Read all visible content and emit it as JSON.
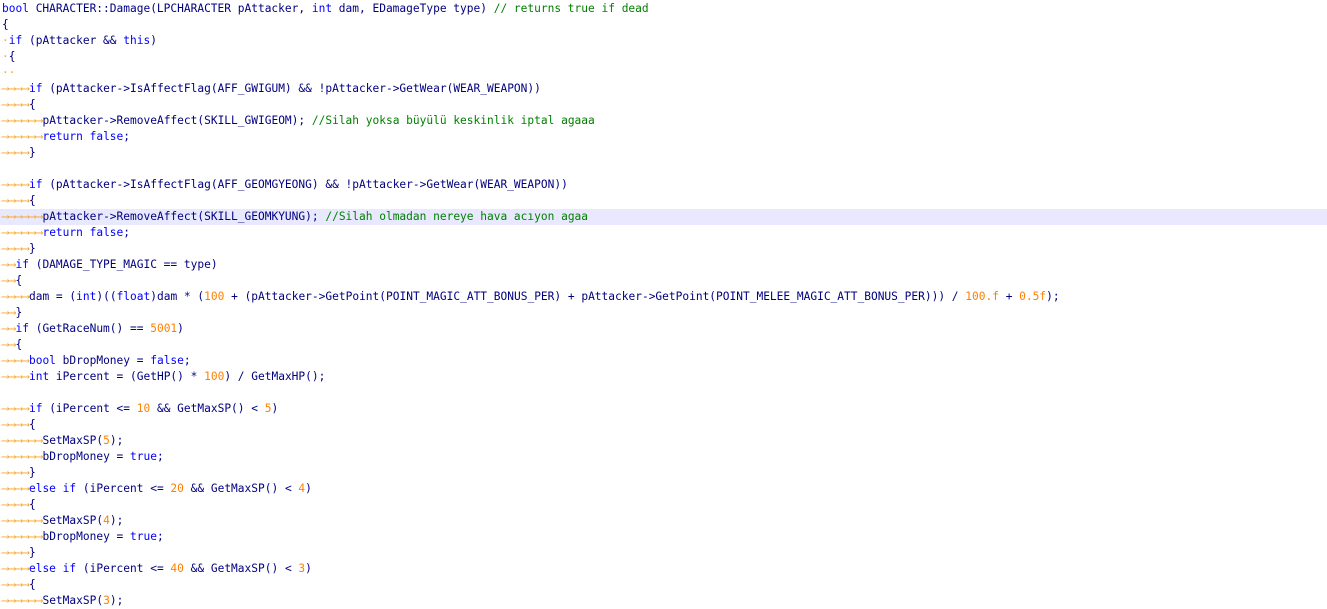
{
  "editor": {
    "tab_arrow": "⟶⟶",
    "lines": [
      {
        "indent": 0,
        "segments": [
          {
            "t": "kw",
            "v": "bool"
          },
          {
            "t": "id",
            "v": " CHARACTER::Damage(LPCHARACTER pAttacker, "
          },
          {
            "t": "kw",
            "v": "int"
          },
          {
            "t": "id",
            "v": " dam, EDamageType type) "
          },
          {
            "t": "cm",
            "v": "// returns true if dead"
          }
        ]
      },
      {
        "indent": 0,
        "segments": [
          {
            "t": "id",
            "v": "{"
          }
        ]
      },
      {
        "indent": 0,
        "segments": [
          {
            "t": "ws",
            "v": "·"
          },
          {
            "t": "kw",
            "v": "if"
          },
          {
            "t": "id",
            "v": " (pAttacker && "
          },
          {
            "t": "kw",
            "v": "this"
          },
          {
            "t": "id",
            "v": ")"
          }
        ]
      },
      {
        "indent": 0,
        "segments": [
          {
            "t": "ws",
            "v": "·"
          },
          {
            "t": "id",
            "v": "{"
          }
        ]
      },
      {
        "indent": 0,
        "segments": [
          {
            "t": "ws",
            "v": "··"
          }
        ]
      },
      {
        "indent": 2,
        "segments": [
          {
            "t": "kw",
            "v": "if"
          },
          {
            "t": "id",
            "v": " (pAttacker->IsAffectFlag(AFF_GWIGUM) && !pAttacker->GetWear(WEAR_WEAPON))"
          }
        ]
      },
      {
        "indent": 2,
        "segments": [
          {
            "t": "id",
            "v": "{"
          }
        ]
      },
      {
        "indent": 3,
        "segments": [
          {
            "t": "id",
            "v": "pAttacker->RemoveAffect(SKILL_GWIGEOM); "
          },
          {
            "t": "cm",
            "v": "//Silah yoksa büyülü keskinlik iptal agaaa"
          }
        ]
      },
      {
        "indent": 3,
        "segments": [
          {
            "t": "kw",
            "v": "return false"
          },
          {
            "t": "id",
            "v": ";"
          }
        ]
      },
      {
        "indent": 2,
        "segments": [
          {
            "t": "id",
            "v": "}"
          }
        ]
      },
      {
        "indent": 0,
        "segments": []
      },
      {
        "indent": 2,
        "segments": [
          {
            "t": "kw",
            "v": "if"
          },
          {
            "t": "id",
            "v": " (pAttacker->IsAffectFlag(AFF_GEOMGYEONG) && !pAttacker->GetWear(WEAR_WEAPON))"
          }
        ]
      },
      {
        "indent": 2,
        "segments": [
          {
            "t": "id",
            "v": "{"
          }
        ]
      },
      {
        "indent": 3,
        "current": true,
        "segments": [
          {
            "t": "id",
            "v": "pAttacker->RemoveAffect(SKILL_GEOMKYUNG); "
          },
          {
            "t": "cm",
            "v": "//Silah olmadan nereye hava acıyon agaa"
          }
        ]
      },
      {
        "indent": 3,
        "segments": [
          {
            "t": "kw",
            "v": "return false"
          },
          {
            "t": "id",
            "v": ";"
          }
        ]
      },
      {
        "indent": 2,
        "segments": [
          {
            "t": "id",
            "v": "}"
          }
        ]
      },
      {
        "indent": 1,
        "segments": [
          {
            "t": "kw",
            "v": "if"
          },
          {
            "t": "id",
            "v": " (DAMAGE_TYPE_MAGIC == type)"
          }
        ]
      },
      {
        "indent": 1,
        "segments": [
          {
            "t": "id",
            "v": "{"
          }
        ]
      },
      {
        "indent": 2,
        "segments": [
          {
            "t": "id",
            "v": "dam = ("
          },
          {
            "t": "kw",
            "v": "int"
          },
          {
            "t": "id",
            "v": ")(("
          },
          {
            "t": "kw",
            "v": "float"
          },
          {
            "t": "id",
            "v": ")dam * ("
          },
          {
            "t": "num",
            "v": "100"
          },
          {
            "t": "id",
            "v": " + (pAttacker->GetPoint(POINT_MAGIC_ATT_BONUS_PER) + pAttacker->GetPoint(POINT_MELEE_MAGIC_ATT_BONUS_PER))) / "
          },
          {
            "t": "num",
            "v": "100.f"
          },
          {
            "t": "id",
            "v": " + "
          },
          {
            "t": "num",
            "v": "0.5f"
          },
          {
            "t": "id",
            "v": ");"
          }
        ]
      },
      {
        "indent": 1,
        "segments": [
          {
            "t": "id",
            "v": "}"
          }
        ]
      },
      {
        "indent": 1,
        "segments": [
          {
            "t": "kw",
            "v": "if"
          },
          {
            "t": "id",
            "v": " (GetRaceNum() == "
          },
          {
            "t": "num",
            "v": "5001"
          },
          {
            "t": "id",
            "v": ")"
          }
        ]
      },
      {
        "indent": 1,
        "segments": [
          {
            "t": "id",
            "v": "{"
          }
        ]
      },
      {
        "indent": 2,
        "segments": [
          {
            "t": "kw",
            "v": "bool"
          },
          {
            "t": "id",
            "v": " bDropMoney = "
          },
          {
            "t": "kw",
            "v": "false"
          },
          {
            "t": "id",
            "v": ";"
          }
        ]
      },
      {
        "indent": 2,
        "segments": [
          {
            "t": "kw",
            "v": "int"
          },
          {
            "t": "id",
            "v": " iPercent = (GetHP() * "
          },
          {
            "t": "num",
            "v": "100"
          },
          {
            "t": "id",
            "v": ") / GetMaxHP();"
          }
        ]
      },
      {
        "indent": 0,
        "segments": []
      },
      {
        "indent": 2,
        "segments": [
          {
            "t": "kw",
            "v": "if"
          },
          {
            "t": "id",
            "v": " (iPercent <= "
          },
          {
            "t": "num",
            "v": "10"
          },
          {
            "t": "id",
            "v": " && GetMaxSP() < "
          },
          {
            "t": "num",
            "v": "5"
          },
          {
            "t": "id",
            "v": ")"
          }
        ]
      },
      {
        "indent": 2,
        "segments": [
          {
            "t": "id",
            "v": "{"
          }
        ]
      },
      {
        "indent": 3,
        "segments": [
          {
            "t": "id",
            "v": "SetMaxSP("
          },
          {
            "t": "num",
            "v": "5"
          },
          {
            "t": "id",
            "v": ");"
          }
        ]
      },
      {
        "indent": 3,
        "segments": [
          {
            "t": "id",
            "v": "bDropMoney = "
          },
          {
            "t": "kw",
            "v": "true"
          },
          {
            "t": "id",
            "v": ";"
          }
        ]
      },
      {
        "indent": 2,
        "segments": [
          {
            "t": "id",
            "v": "}"
          }
        ]
      },
      {
        "indent": 2,
        "segments": [
          {
            "t": "kw",
            "v": "else if"
          },
          {
            "t": "id",
            "v": " (iPercent <= "
          },
          {
            "t": "num",
            "v": "20"
          },
          {
            "t": "id",
            "v": " && GetMaxSP() < "
          },
          {
            "t": "num",
            "v": "4"
          },
          {
            "t": "id",
            "v": ")"
          }
        ]
      },
      {
        "indent": 2,
        "segments": [
          {
            "t": "id",
            "v": "{"
          }
        ]
      },
      {
        "indent": 3,
        "segments": [
          {
            "t": "id",
            "v": "SetMaxSP("
          },
          {
            "t": "num",
            "v": "4"
          },
          {
            "t": "id",
            "v": ");"
          }
        ]
      },
      {
        "indent": 3,
        "segments": [
          {
            "t": "id",
            "v": "bDropMoney = "
          },
          {
            "t": "kw",
            "v": "true"
          },
          {
            "t": "id",
            "v": ";"
          }
        ]
      },
      {
        "indent": 2,
        "segments": [
          {
            "t": "id",
            "v": "}"
          }
        ]
      },
      {
        "indent": 2,
        "segments": [
          {
            "t": "kw",
            "v": "else if"
          },
          {
            "t": "id",
            "v": " (iPercent <= "
          },
          {
            "t": "num",
            "v": "40"
          },
          {
            "t": "id",
            "v": " && GetMaxSP() < "
          },
          {
            "t": "num",
            "v": "3"
          },
          {
            "t": "id",
            "v": ")"
          }
        ]
      },
      {
        "indent": 2,
        "segments": [
          {
            "t": "id",
            "v": "{"
          }
        ]
      },
      {
        "indent": 3,
        "segments": [
          {
            "t": "id",
            "v": "SetMaxSP("
          },
          {
            "t": "num",
            "v": "3"
          },
          {
            "t": "id",
            "v": ");"
          }
        ]
      }
    ]
  },
  "colors": {
    "keyword": "#0000ff",
    "identifier": "#000080",
    "number": "#ff8000",
    "comment": "#008000",
    "whitespace": "#f5a623",
    "current_line": "#e8e8ff"
  }
}
